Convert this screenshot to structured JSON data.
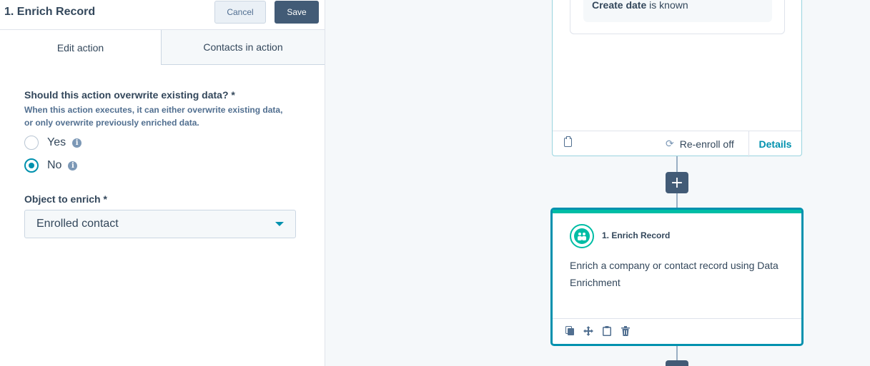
{
  "panel": {
    "title": "1. Enrich Record",
    "cancel_label": "Cancel",
    "save_label": "Save",
    "tabs": [
      {
        "label": "Edit action",
        "active": true
      },
      {
        "label": "Contacts in action",
        "active": false
      }
    ],
    "question": "Should this action overwrite existing data? *",
    "help_text": "When this action executes, it can either overwrite existing data, or only overwrite previously enriched data.",
    "options": [
      {
        "label": "Yes",
        "selected": false
      },
      {
        "label": "No",
        "selected": true
      }
    ],
    "object_label": "Object to enrich *",
    "object_value": "Enrolled contact"
  },
  "canvas": {
    "previous_card": {
      "filter_property": "Create date",
      "filter_condition": "is known",
      "reenroll_label": "Re-enroll off",
      "details_label": "Details"
    },
    "add_button_label": "+",
    "action_card": {
      "title": "1. Enrich Record",
      "description": "Enrich a company or contact record using Data Enrichment"
    }
  },
  "colors": {
    "accent": "#0091ae",
    "action_green": "#00bda5",
    "button_dark": "#425b76"
  }
}
